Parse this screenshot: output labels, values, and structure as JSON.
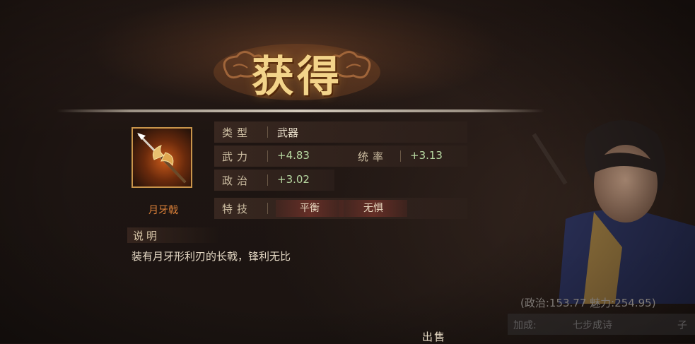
{
  "popup": {
    "title": "获得"
  },
  "item": {
    "name": "月牙戟",
    "icon": "crescent-halberd-icon",
    "type_label": "类型",
    "type_value": "武器",
    "stats": [
      {
        "label": "武力",
        "value": "+4.83"
      },
      {
        "label": "统率",
        "value": "+3.13"
      },
      {
        "label": "政治",
        "value": "+3.02"
      }
    ],
    "skill_label": "特技",
    "skills": [
      "平衡",
      "无惧"
    ],
    "desc_label": "说明",
    "description": "装有月牙形利刃的长戟，锋利无比"
  },
  "background": {
    "stat_readout": "(政治:153.77 魅力:254.95)",
    "tag_left": "加成:",
    "tag_mid": "七步成诗",
    "tag_right": "子"
  },
  "actions": {
    "sell_label": "出售"
  },
  "colors": {
    "title": "#f3d48a",
    "item_name": "#e0833a",
    "stat_value": "#b8d8a2",
    "icon_frame": "#c9954b"
  }
}
